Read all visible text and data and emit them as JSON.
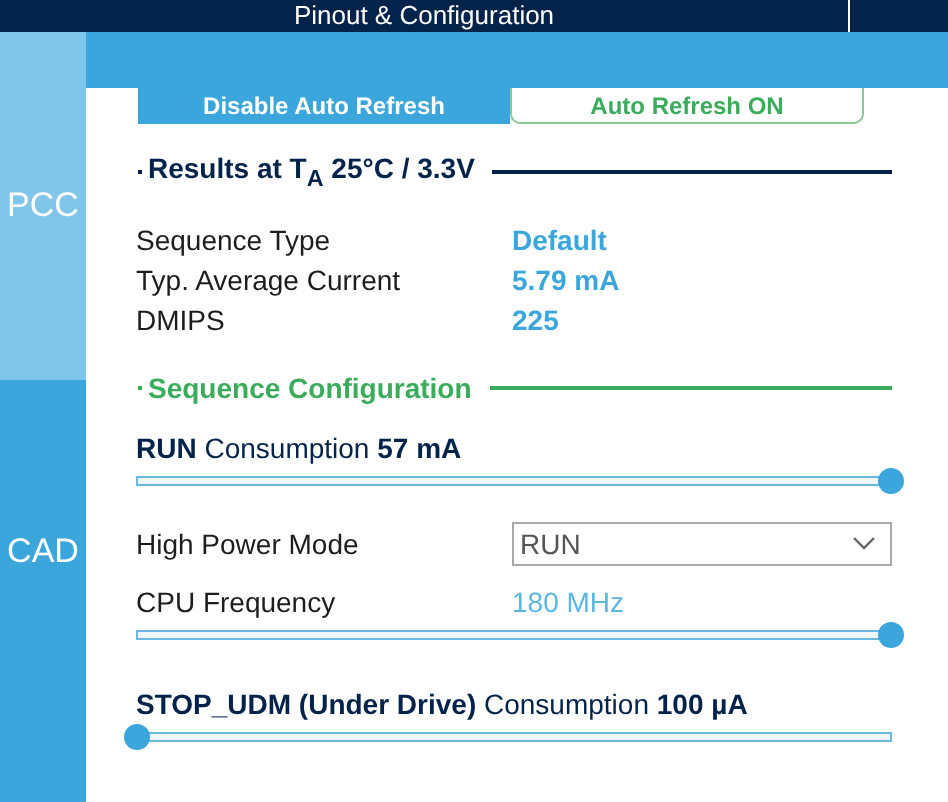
{
  "title": "Pinout & Configuration",
  "sidebar": [
    {
      "label": "PCC",
      "selected": false
    },
    {
      "label": "CAD",
      "selected": true
    }
  ],
  "buttons": [
    {
      "label": "Disable Auto Refresh",
      "kind": "filled"
    },
    {
      "label": "Auto Refresh ON",
      "kind": "outline"
    }
  ],
  "results": {
    "heading": "Results at T$_{A}$ 25°C / 3.3V",
    "rows": [
      {
        "label": "Sequence Type",
        "value": "Default"
      },
      {
        "label": "Typ. Average Current",
        "value": "5.79 mA"
      },
      {
        "label": "DMIPS",
        "value": "225"
      }
    ]
  },
  "sequence": {
    "heading": "Sequence Configuration",
    "items": [
      {
        "kind": "slider",
        "label": "**RUN** Consumption **57 mA**",
        "level": 1
      },
      {
        "kind": "select",
        "label": "High Power Mode",
        "value": "RUN"
      },
      {
        "kind": "reading",
        "label": "CPU Frequency",
        "value": "180 MHz",
        "level": 1
      },
      {
        "kind": "slider",
        "label": "**STOP_UDM (Under Drive)** Consumption **100 µA**",
        "level": 0
      }
    ]
  }
}
